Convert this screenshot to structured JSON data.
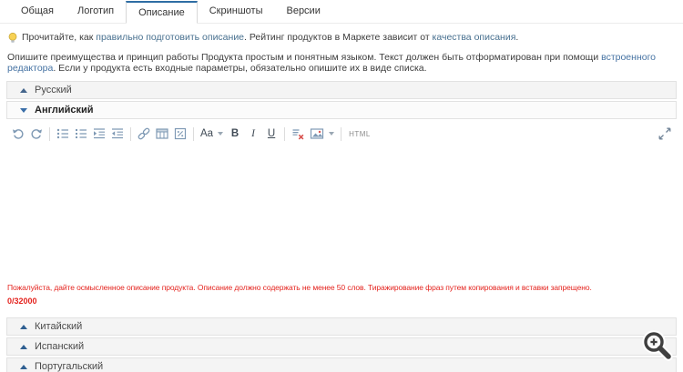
{
  "tabs": [
    {
      "label": "Общая",
      "active": false
    },
    {
      "label": "Логотип",
      "active": false
    },
    {
      "label": "Описание",
      "active": true
    },
    {
      "label": "Скриншоты",
      "active": false
    },
    {
      "label": "Версии",
      "active": false
    }
  ],
  "tip": {
    "icon": "lightbulb-icon",
    "pre": "Прочитайте, как ",
    "link1": "правильно подготовить описание",
    "mid": ". Рейтинг продуктов в Маркете зависит от ",
    "link2": "качества описания",
    "end": "."
  },
  "intro": {
    "pre": "Опишите преимущества и принцип работы Продукта простым и понятным языком. Текст должен быть отформатирован при помощи ",
    "link": "встроенного редактора",
    "post": ". Если у продукта есть входные параметры, обязательно опишите их в виде списка."
  },
  "sections": {
    "russian": "Русский",
    "english": "Английский",
    "chinese": "Китайский",
    "spanish": "Испанский",
    "portuguese": "Португальский"
  },
  "editor": {
    "toolbar": {
      "icons": [
        "undo-icon",
        "redo-icon",
        "unordered-list-icon",
        "ordered-list-icon",
        "indent-icon",
        "outdent-icon",
        "link-icon",
        "table-icon",
        "insert-variable-icon",
        "font-style-dropdown",
        "bold",
        "italic",
        "underline",
        "clear-formatting-icon",
        "insert-image-icon",
        "html-source-button",
        "fullscreen-icon"
      ],
      "font_label": "Aa",
      "bold_label": "B",
      "italic_label": "I",
      "underline_label": "U",
      "html_label": "HTML"
    },
    "content": "",
    "error": "Пожалуйста, дайте осмысленное описание продукта. Описание должно содержать не менее 50 слов. Тиражирование фраз путем копирования и вставки запрещено.",
    "counter": "0/32000"
  },
  "overlay": {
    "icon": "zoom-in-magnifier-icon"
  },
  "colors": {
    "accent_tab": "#2e6da4",
    "link": "#48708f",
    "link_blue": "#4673a3",
    "error": "#e4231e",
    "toolbar_icon": "#7e99b4",
    "section_bg": "#f4f4f4"
  }
}
